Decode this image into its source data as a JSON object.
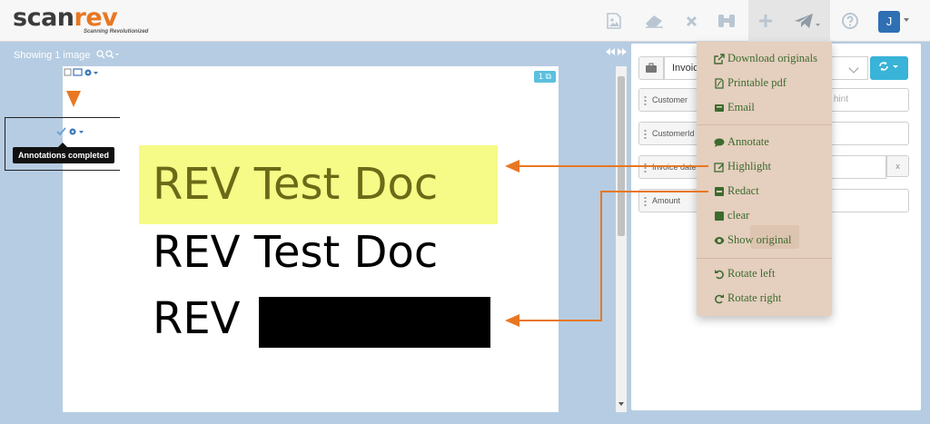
{
  "app": {
    "logo_main": "scan",
    "logo_accent": "rev",
    "logo_tagline": "Scanning Revolutionized",
    "user_initial": "J"
  },
  "toolbar": {
    "showing_text": "Showing 1 image",
    "zoom_icons": "QQ",
    "page_nav": "◂◂ ▸▸"
  },
  "viewer": {
    "page_badge": "1",
    "tooltip": "Annotations completed",
    "document_lines": [
      "REV Test Doc",
      "REV Test Doc",
      "REV"
    ]
  },
  "form": {
    "document_type": "Invoices",
    "fields": [
      {
        "label": "Customer",
        "hint": "hint"
      },
      {
        "label": "CustomerId",
        "hint": ""
      },
      {
        "label": "Invoice date",
        "hint": ""
      },
      {
        "label": "Amount",
        "hint": ""
      }
    ],
    "clear_x": "x"
  },
  "menu": {
    "items": [
      {
        "label": "Download originals",
        "icon": "external-link-icon"
      },
      {
        "label": "Printable pdf",
        "icon": "pdf-icon"
      },
      {
        "label": "Email",
        "icon": "email-icon"
      },
      {
        "label": "Annotate",
        "icon": "comment-icon"
      },
      {
        "label": "Highlight",
        "icon": "edit-icon"
      },
      {
        "label": "Redact",
        "icon": "minus-square-icon"
      },
      {
        "label": "clear",
        "icon": "square-icon"
      },
      {
        "label": "Show original",
        "icon": "eye-icon"
      },
      {
        "label": "Rotate left",
        "icon": "rotate-left-icon"
      },
      {
        "label": "Rotate right",
        "icon": "rotate-right-icon"
      }
    ]
  },
  "colors": {
    "accent_orange": "#e87722",
    "highlight_yellow": "#f6fa86",
    "menu_bg": "#e5cfbf",
    "menu_text": "#3c6b2e",
    "brand_blue": "#2f6fb3"
  }
}
